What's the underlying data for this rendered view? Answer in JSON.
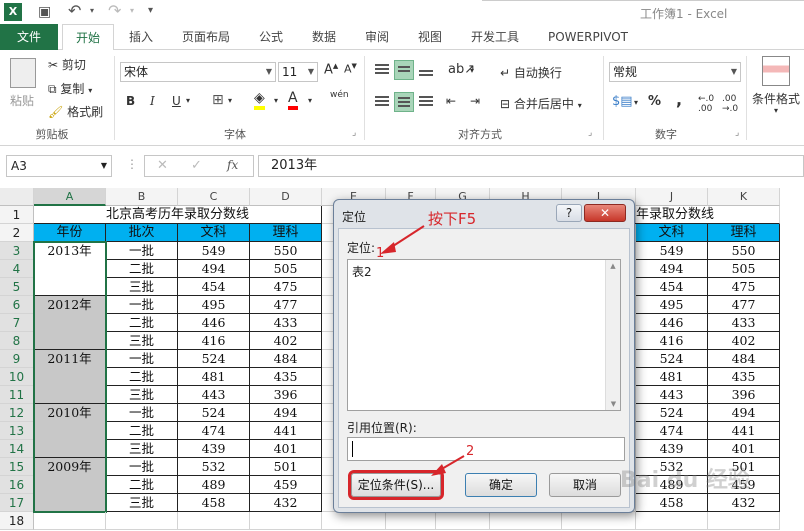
{
  "window": {
    "title": "工作簿1 - Excel"
  },
  "ribbon_tabs": [
    "文件",
    "开始",
    "插入",
    "页面布局",
    "公式",
    "数据",
    "审阅",
    "视图",
    "开发工具",
    "POWERPIVOT"
  ],
  "clipboard": {
    "paste": "粘贴",
    "cut": "剪切",
    "copy": "复制",
    "format_painter": "格式刷",
    "group": "剪贴板"
  },
  "font": {
    "name": "宋体",
    "size": "11",
    "bold": "B",
    "italic": "I",
    "underline": "U",
    "phonetic": "wén",
    "group": "字体"
  },
  "alignment": {
    "wrap": "自动换行",
    "merge": "合并后居中",
    "group": "对齐方式"
  },
  "number": {
    "format": "常规",
    "percent": "%",
    "comma": ",",
    "group": "数字"
  },
  "styles": {
    "conditional": "条件格式"
  },
  "formula_bar": {
    "name_box": "A3",
    "fx": "fx",
    "value": "2013年"
  },
  "columns": [
    "A",
    "B",
    "C",
    "D",
    "E",
    "F",
    "G",
    "H",
    "I",
    "J",
    "K"
  ],
  "rows": [
    "1",
    "2",
    "3",
    "4",
    "5",
    "6",
    "7",
    "8",
    "9",
    "10",
    "11",
    "12",
    "13",
    "14",
    "15",
    "16",
    "17",
    "18"
  ],
  "sheet": {
    "title": "北京高考历年录取分数线",
    "title_right": "年录取分数线",
    "headers": [
      "年份",
      "批次",
      "文科",
      "理科"
    ],
    "headers_right": [
      "文科",
      "理科"
    ],
    "years": [
      "2013年",
      "2012年",
      "2011年",
      "2010年",
      "2009年"
    ],
    "batches": [
      "一批",
      "二批",
      "三批"
    ],
    "wenke": [
      "549",
      "494",
      "454",
      "495",
      "446",
      "416",
      "524",
      "481",
      "443",
      "524",
      "474",
      "439",
      "532",
      "489",
      "458"
    ],
    "like": [
      "550",
      "505",
      "475",
      "477",
      "433",
      "402",
      "484",
      "435",
      "396",
      "494",
      "441",
      "401",
      "501",
      "459",
      "432"
    ],
    "right_j": [
      "549",
      "494",
      "454",
      "495",
      "446",
      "416",
      "524",
      "481",
      "443",
      "524",
      "474",
      "439",
      "532",
      "489",
      "458"
    ],
    "right_k": [
      "550",
      "505",
      "475",
      "477",
      "433",
      "402",
      "484",
      "435",
      "396",
      "494",
      "441",
      "401",
      "501",
      "459",
      "432"
    ]
  },
  "dialog": {
    "title": "定位",
    "help": "?",
    "close": "✕",
    "goto_label": "定位:",
    "list_items": [
      "表2"
    ],
    "ref_label": "引用位置(R):",
    "ref_value": "",
    "special_button": "定位条件(S)...",
    "ok_button": "确定",
    "cancel_button": "取消"
  },
  "annotations": {
    "step1_text": "按下F5",
    "step1_num": "1",
    "step2_num": "2"
  },
  "watermark": "Bai du 经验",
  "colors": {
    "accent_green": "#217346",
    "header_cyan": "#00b0f0",
    "selection_gray": "#c8c8c8",
    "annotation_red": "#d7262b"
  }
}
